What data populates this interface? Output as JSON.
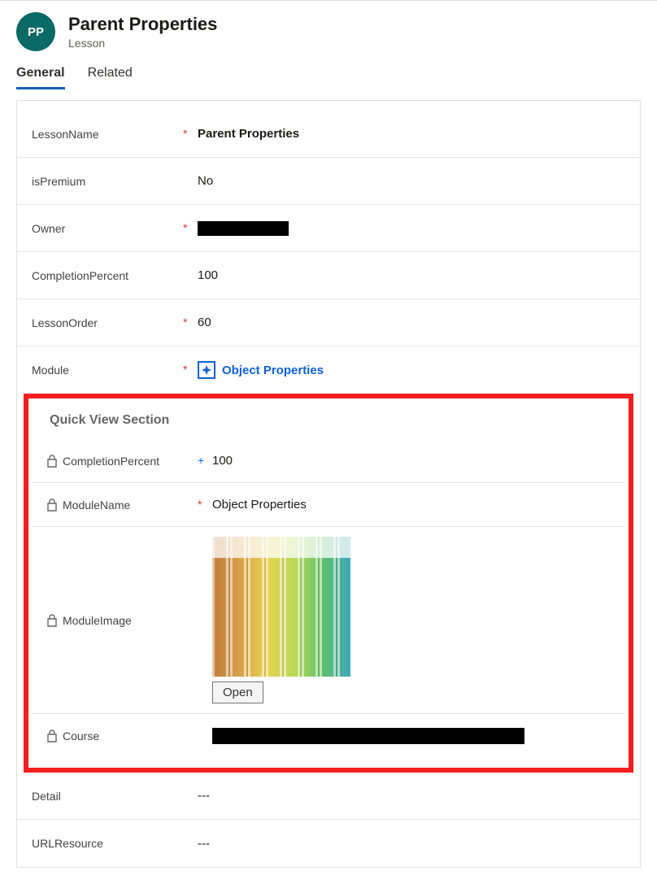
{
  "header": {
    "initials": "PP",
    "title": "Parent Properties",
    "subtitle": "Lesson"
  },
  "tabs": {
    "general": "General",
    "related": "Related"
  },
  "fields": {
    "lessonName": {
      "label": "LessonName",
      "value": "Parent Properties"
    },
    "isPremium": {
      "label": "isPremium",
      "value": "No"
    },
    "owner": {
      "label": "Owner"
    },
    "completionPercent": {
      "label": "CompletionPercent",
      "value": "100"
    },
    "lessonOrder": {
      "label": "LessonOrder",
      "value": "60"
    },
    "module": {
      "label": "Module",
      "value": "Object Properties"
    },
    "detail": {
      "label": "Detail",
      "value": "---"
    },
    "urlResource": {
      "label": "URLResource",
      "value": "---"
    }
  },
  "quickView": {
    "title": "Quick View Section",
    "completionPercent": {
      "label": "CompletionPercent",
      "value": "100"
    },
    "moduleName": {
      "label": "ModuleName",
      "value": "Object Properties"
    },
    "moduleImage": {
      "label": "ModuleImage",
      "openLabel": "Open"
    },
    "course": {
      "label": "Course"
    }
  }
}
